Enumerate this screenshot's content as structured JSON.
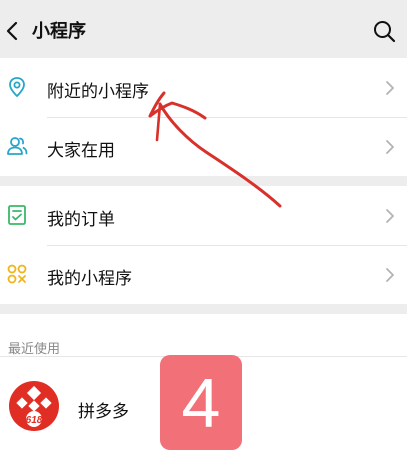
{
  "header": {
    "title": "小程序"
  },
  "groups": {
    "discover": [
      {
        "label": "附近的小程序"
      },
      {
        "label": "大家在用"
      }
    ],
    "mine": [
      {
        "label": "我的订单"
      },
      {
        "label": "我的小程序"
      }
    ]
  },
  "recent": {
    "section_label": "最近使用",
    "apps": [
      {
        "name": "拼多多",
        "icon_text": "618"
      }
    ]
  },
  "overlay": {
    "badge_number": "4"
  },
  "colors": {
    "background": "#ededed",
    "accent_blue": "#27a6c9",
    "accent_green": "#3bb76a",
    "accent_yellow": "#f1b51c",
    "annotation_red": "#d8302b",
    "badge": "#f27077",
    "pinduoduo_red": "#e02e24"
  },
  "icons": {
    "back": "chevron-left-icon",
    "search": "search-icon",
    "nearby": "location-pin-icon",
    "popular": "people-icon",
    "orders": "checklist-icon",
    "my_apps": "apps-icon",
    "chevron": "chevron-right-icon"
  }
}
